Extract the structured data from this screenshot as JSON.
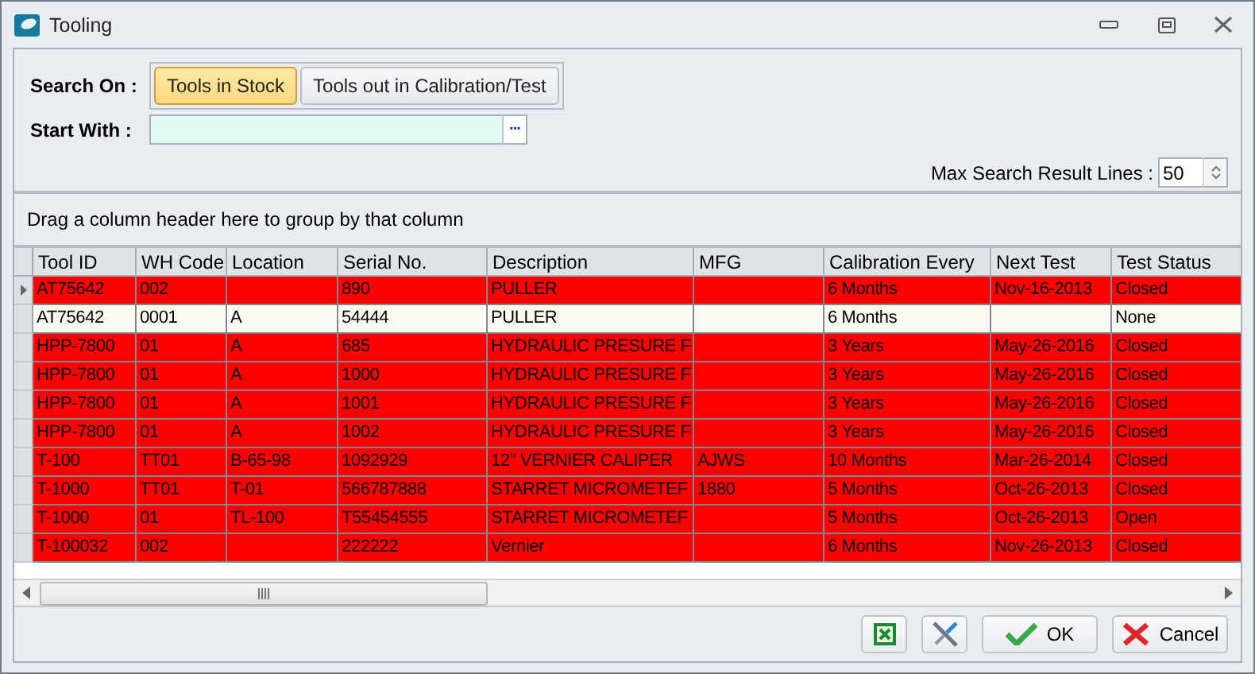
{
  "window": {
    "title": "Tooling"
  },
  "search": {
    "label": "Search On :",
    "options": [
      {
        "label": "Tools in Stock",
        "selected": true
      },
      {
        "label": "Tools out in Calibration/Test",
        "selected": false
      }
    ]
  },
  "start_with": {
    "label": "Start With :",
    "browse": "···"
  },
  "max_lines": {
    "label": "Max Search Result Lines :",
    "value": "50"
  },
  "group_panel": "Drag a column header here to group by that column",
  "table": {
    "columns": [
      "Tool ID",
      "WH Code",
      "Location",
      "Serial No.",
      "Description",
      "MFG",
      "Calibration Every",
      "Next Test",
      "Test Status"
    ],
    "rows": [
      {
        "current": true,
        "flagged": true,
        "cells": [
          "AT75642",
          "002",
          "",
          "890",
          "PULLER",
          "",
          "6  Months",
          "Nov-16-2013",
          "Closed"
        ]
      },
      {
        "current": false,
        "flagged": false,
        "cells": [
          "AT75642",
          "0001",
          "A",
          "54444",
          "PULLER",
          "",
          "6  Months",
          "",
          "None"
        ]
      },
      {
        "current": false,
        "flagged": true,
        "cells": [
          "HPP-7800",
          "01",
          "A",
          "685",
          "HYDRAULIC PRESURE F",
          "",
          "3  Years",
          "May-26-2016",
          "Closed"
        ]
      },
      {
        "current": false,
        "flagged": true,
        "cells": [
          "HPP-7800",
          "01",
          "A",
          "1000",
          "HYDRAULIC PRESURE F",
          "",
          "3  Years",
          "May-26-2016",
          "Closed"
        ]
      },
      {
        "current": false,
        "flagged": true,
        "cells": [
          "HPP-7800",
          "01",
          "A",
          "1001",
          "HYDRAULIC PRESURE F",
          "",
          "3  Years",
          "May-26-2016",
          "Closed"
        ]
      },
      {
        "current": false,
        "flagged": true,
        "cells": [
          "HPP-7800",
          "01",
          "A",
          "1002",
          "HYDRAULIC PRESURE F",
          "",
          "3  Years",
          "May-26-2016",
          "Closed"
        ]
      },
      {
        "current": false,
        "flagged": true,
        "cells": [
          "T-100",
          "TT01",
          "B-65-98",
          "1092929",
          "12\" VERNIER CALIPER",
          "AJWS",
          "10  Months",
          "Mar-26-2014",
          "Closed"
        ]
      },
      {
        "current": false,
        "flagged": true,
        "cells": [
          "T-1000",
          "TT01",
          "T-01",
          "566787888",
          "STARRET MICROMETEF",
          "1880",
          "5  Months",
          "Oct-26-2013",
          "Closed"
        ]
      },
      {
        "current": false,
        "flagged": true,
        "cells": [
          "T-1000",
          "01",
          "TL-100",
          "T55454555",
          "STARRET MICROMETEF",
          "",
          "5  Months",
          "Oct-26-2013",
          "Open"
        ]
      },
      {
        "current": false,
        "flagged": true,
        "cells": [
          "T-100032",
          "002",
          "",
          "222222",
          "Vernier",
          "",
          "6  Months",
          "Nov-26-2013",
          "Closed"
        ]
      }
    ]
  },
  "buttons": [
    {
      "kind": "excel"
    },
    {
      "kind": "tools"
    },
    {
      "kind": "ok",
      "label": "OK"
    },
    {
      "kind": "cancel",
      "label": "Cancel"
    }
  ]
}
